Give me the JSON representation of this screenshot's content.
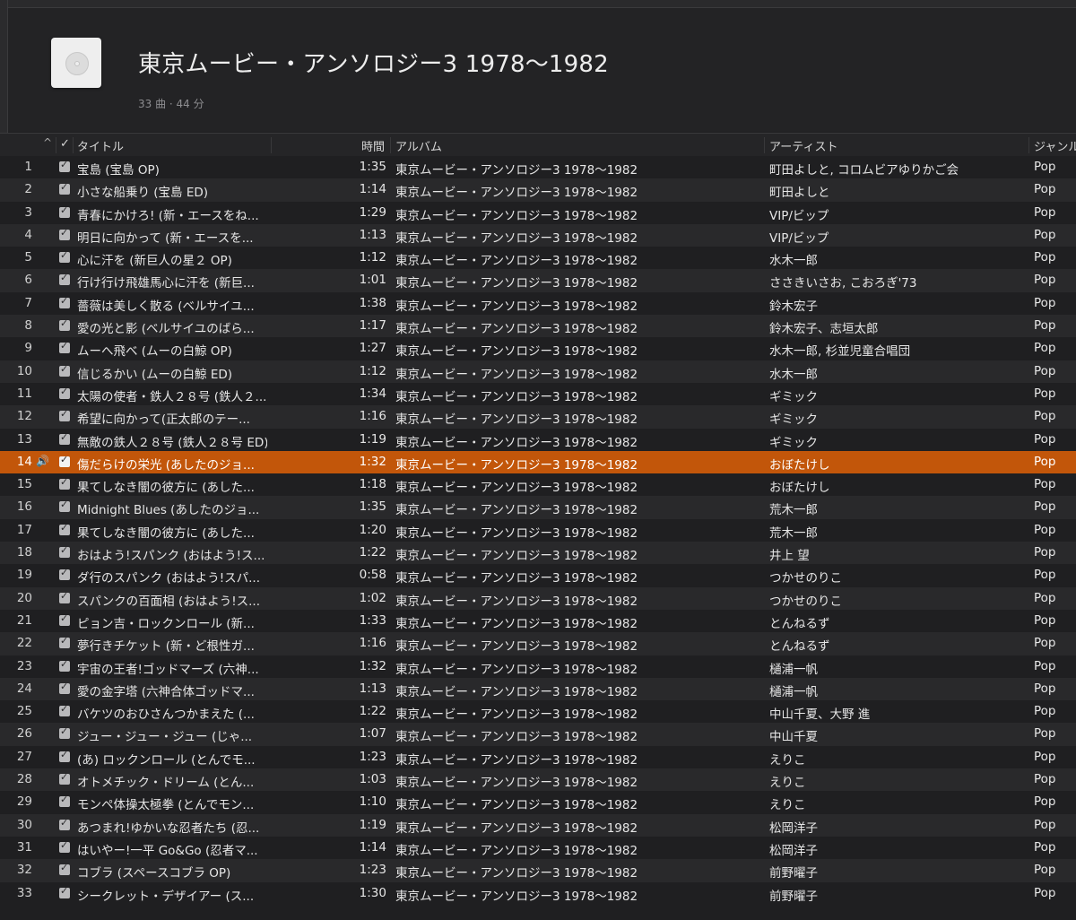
{
  "playlist": {
    "title": "東京ムービー・アンソロジー3 1978〜1982",
    "meta": "33 曲 · 44 分"
  },
  "columns": {
    "sort": "^",
    "check": "✓",
    "title": "タイトル",
    "time": "時間",
    "album": "アルバム",
    "artist": "アーティスト",
    "genre": "ジャンル"
  },
  "playing_index": 14,
  "tracks": [
    {
      "num": "1",
      "title": "宝島 (宝島 OP)",
      "time": "1:35",
      "album": "東京ムービー・アンソロジー3 1978〜1982",
      "artist": "町田よしと, コロムビアゆりかご会",
      "genre": "Pop"
    },
    {
      "num": "2",
      "title": "小さな船乗り (宝島 ED)",
      "time": "1:14",
      "album": "東京ムービー・アンソロジー3 1978〜1982",
      "artist": "町田よしと",
      "genre": "Pop"
    },
    {
      "num": "3",
      "title": "青春にかけろ! (新・エースをね...",
      "time": "1:29",
      "album": "東京ムービー・アンソロジー3 1978〜1982",
      "artist": "VIP/ビップ",
      "genre": "Pop"
    },
    {
      "num": "4",
      "title": "明日に向かって (新・エースを...",
      "time": "1:13",
      "album": "東京ムービー・アンソロジー3 1978〜1982",
      "artist": "VIP/ビップ",
      "genre": "Pop"
    },
    {
      "num": "5",
      "title": "心に汗を (新巨人の星２ OP)",
      "time": "1:12",
      "album": "東京ムービー・アンソロジー3 1978〜1982",
      "artist": "水木一郎",
      "genre": "Pop"
    },
    {
      "num": "6",
      "title": "行け行け飛雄馬心に汗を (新巨...",
      "time": "1:01",
      "album": "東京ムービー・アンソロジー3 1978〜1982",
      "artist": "ささきいさお, こおろぎ'73",
      "genre": "Pop"
    },
    {
      "num": "7",
      "title": "薔薇は美しく散る (ベルサイユ...",
      "time": "1:38",
      "album": "東京ムービー・アンソロジー3 1978〜1982",
      "artist": "鈴木宏子",
      "genre": "Pop"
    },
    {
      "num": "8",
      "title": "愛の光と影 (ベルサイユのばら...",
      "time": "1:17",
      "album": "東京ムービー・アンソロジー3 1978〜1982",
      "artist": "鈴木宏子、志垣太郎",
      "genre": "Pop"
    },
    {
      "num": "9",
      "title": "ムーへ飛べ (ムーの白鯨 OP)",
      "time": "1:27",
      "album": "東京ムービー・アンソロジー3 1978〜1982",
      "artist": "水木一郎, 杉並児童合唱団",
      "genre": "Pop"
    },
    {
      "num": "10",
      "title": "信じるかい (ムーの白鯨 ED)",
      "time": "1:12",
      "album": "東京ムービー・アンソロジー3 1978〜1982",
      "artist": "水木一郎",
      "genre": "Pop"
    },
    {
      "num": "11",
      "title": "太陽の使者・鉄人２８号 (鉄人２...",
      "time": "1:34",
      "album": "東京ムービー・アンソロジー3 1978〜1982",
      "artist": "ギミック",
      "genre": "Pop"
    },
    {
      "num": "12",
      "title": "希望に向かって(正太郎のテー...",
      "time": "1:16",
      "album": "東京ムービー・アンソロジー3 1978〜1982",
      "artist": "ギミック",
      "genre": "Pop"
    },
    {
      "num": "13",
      "title": "無敵の鉄人２８号 (鉄人２８号 ED)",
      "time": "1:19",
      "album": "東京ムービー・アンソロジー3 1978〜1982",
      "artist": "ギミック",
      "genre": "Pop"
    },
    {
      "num": "14",
      "title": "傷だらけの栄光 (あしたのジョ...",
      "time": "1:32",
      "album": "東京ムービー・アンソロジー3 1978〜1982",
      "artist": "おぼたけし",
      "genre": "Pop"
    },
    {
      "num": "15",
      "title": "果てしなき闇の彼方に (あした...",
      "time": "1:18",
      "album": "東京ムービー・アンソロジー3 1978〜1982",
      "artist": "おぼたけし",
      "genre": "Pop"
    },
    {
      "num": "16",
      "title": "Midnight Blues (あしたのジョ...",
      "time": "1:35",
      "album": "東京ムービー・アンソロジー3 1978〜1982",
      "artist": "荒木一郎",
      "genre": "Pop"
    },
    {
      "num": "17",
      "title": "果てしなき闇の彼方に (あした...",
      "time": "1:20",
      "album": "東京ムービー・アンソロジー3 1978〜1982",
      "artist": "荒木一郎",
      "genre": "Pop"
    },
    {
      "num": "18",
      "title": "おはよう!スパンク (おはよう!ス...",
      "time": "1:22",
      "album": "東京ムービー・アンソロジー3 1978〜1982",
      "artist": "井上 望",
      "genre": "Pop"
    },
    {
      "num": "19",
      "title": "ダ行のスパンク (おはよう!スパ...",
      "time": "0:58",
      "album": "東京ムービー・アンソロジー3 1978〜1982",
      "artist": "つかせのりこ",
      "genre": "Pop"
    },
    {
      "num": "20",
      "title": "スパンクの百面相 (おはよう!ス...",
      "time": "1:02",
      "album": "東京ムービー・アンソロジー3 1978〜1982",
      "artist": "つかせのりこ",
      "genre": "Pop"
    },
    {
      "num": "21",
      "title": "ピョン吉・ロックンロール (新...",
      "time": "1:33",
      "album": "東京ムービー・アンソロジー3 1978〜1982",
      "artist": "とんねるず",
      "genre": "Pop"
    },
    {
      "num": "22",
      "title": "夢行きチケット (新・ど根性ガ...",
      "time": "1:16",
      "album": "東京ムービー・アンソロジー3 1978〜1982",
      "artist": "とんねるず",
      "genre": "Pop"
    },
    {
      "num": "23",
      "title": "宇宙の王者!ゴッドマーズ (六神...",
      "time": "1:32",
      "album": "東京ムービー・アンソロジー3 1978〜1982",
      "artist": "樋浦一帆",
      "genre": "Pop"
    },
    {
      "num": "24",
      "title": "愛の金字塔 (六神合体ゴッドマ...",
      "time": "1:13",
      "album": "東京ムービー・アンソロジー3 1978〜1982",
      "artist": "樋浦一帆",
      "genre": "Pop"
    },
    {
      "num": "25",
      "title": "バケツのおひさんつかまえた (...",
      "time": "1:22",
      "album": "東京ムービー・アンソロジー3 1978〜1982",
      "artist": "中山千夏、大野 進",
      "genre": "Pop"
    },
    {
      "num": "26",
      "title": "ジュー・ジュー・ジュー (じゃ...",
      "time": "1:07",
      "album": "東京ムービー・アンソロジー3 1978〜1982",
      "artist": "中山千夏",
      "genre": "Pop"
    },
    {
      "num": "27",
      "title": "(あ) ロックンロール (とんでモ...",
      "time": "1:23",
      "album": "東京ムービー・アンソロジー3 1978〜1982",
      "artist": "えりこ",
      "genre": "Pop"
    },
    {
      "num": "28",
      "title": "オトメチック・ドリーム (とん...",
      "time": "1:03",
      "album": "東京ムービー・アンソロジー3 1978〜1982",
      "artist": "えりこ",
      "genre": "Pop"
    },
    {
      "num": "29",
      "title": "モンペ体操太極拳 (とんでモン...",
      "time": "1:10",
      "album": "東京ムービー・アンソロジー3 1978〜1982",
      "artist": "えりこ",
      "genre": "Pop"
    },
    {
      "num": "30",
      "title": "あつまれ!ゆかいな忍者たち (忍...",
      "time": "1:19",
      "album": "東京ムービー・アンソロジー3 1978〜1982",
      "artist": "松岡洋子",
      "genre": "Pop"
    },
    {
      "num": "31",
      "title": "はいやー!一平 Go&Go (忍者マ...",
      "time": "1:14",
      "album": "東京ムービー・アンソロジー3 1978〜1982",
      "artist": "松岡洋子",
      "genre": "Pop"
    },
    {
      "num": "32",
      "title": "コブラ (スペースコブラ OP)",
      "time": "1:23",
      "album": "東京ムービー・アンソロジー3 1978〜1982",
      "artist": "前野曜子",
      "genre": "Pop"
    },
    {
      "num": "33",
      "title": "シークレット・デザイアー (ス...",
      "time": "1:30",
      "album": "東京ムービー・アンソロジー3 1978〜1982",
      "artist": "前野曜子",
      "genre": "Pop"
    }
  ]
}
